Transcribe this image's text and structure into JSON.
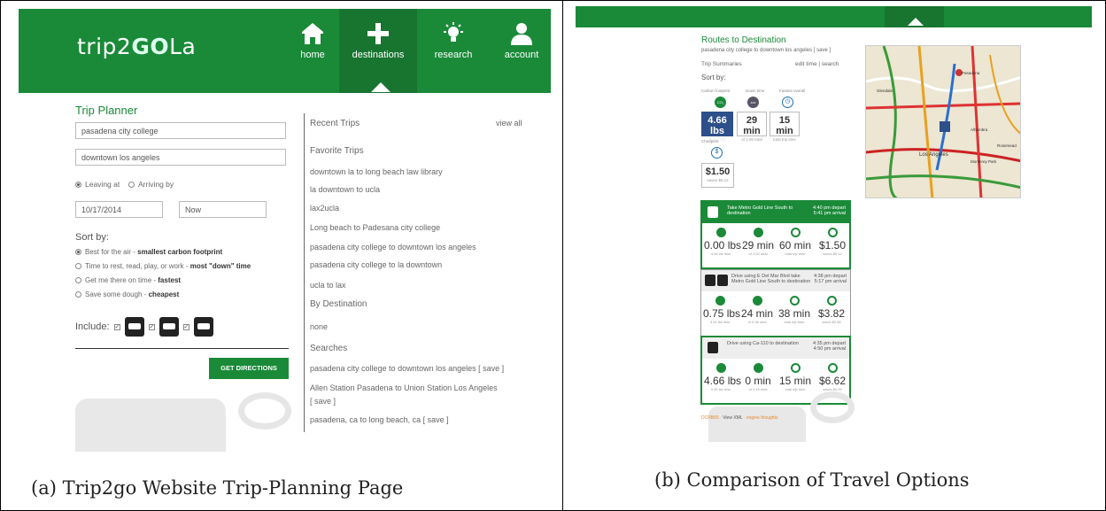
{
  "panel_a": {
    "logo_left": "trip2",
    "logo_mid": "GO",
    "logo_right": "La",
    "nav": [
      {
        "label": "home",
        "icon": "home-icon"
      },
      {
        "label": "destinations",
        "icon": "plus-icon"
      },
      {
        "label": "research",
        "icon": "lightbulb-icon"
      },
      {
        "label": "account",
        "icon": "user-icon"
      }
    ],
    "trip_planner_title": "Trip Planner",
    "from_value": "pasadena city college",
    "to_value": "downtown los angeles",
    "leaving_at": "Leaving at",
    "arriving_by": "Arriving by",
    "date_value": "10/17/2014",
    "time_value": "Now",
    "sort_by": "Sort by:",
    "sort_options": [
      {
        "pre": "Best for the air - ",
        "bold": "smallest carbon footprint"
      },
      {
        "pre": "Time to rest, read, play, or work - ",
        "bold": "most \"down\" time"
      },
      {
        "pre": "Get me there on time - ",
        "bold": "fastest"
      },
      {
        "pre": "Save some dough - ",
        "bold": "cheapest"
      }
    ],
    "include_label": "Include:",
    "get_directions": "GET DIRECTIONS",
    "recent_trips": "Recent Trips",
    "view_all": "view all",
    "favorite_trips": "Favorite Trips",
    "favorites": [
      "downtown la to long beach law library",
      "la downtown to ucla",
      "lax2ucla",
      "Long beach to Padesana city college",
      "pasadena city college to downtown los angeles",
      "pasadena city college to la downtown",
      "ucla to lax"
    ],
    "by_destination": "By Destination",
    "by_destination_value": "none",
    "searches": "Searches",
    "search_items": [
      "pasadena city college to downtown los angeles  [ save ]",
      "Allen Station Pasadena to Union Station Los Angeles",
      "[ save ]",
      "pasadena, ca to long beach, ca  [ save ]"
    ],
    "caption": "(a)  Trip2go Website Trip-Planning Page"
  },
  "panel_b": {
    "title": "Routes to Destination",
    "subtitle": "pasadena city college to downtown los angeles  [ save ]",
    "trip_summaries": "Trip Summaries",
    "edit_links": "edit time  |  search",
    "sort_by": "Sort by:",
    "sort_minis": [
      "Carbon footprint",
      "Down time",
      "Fastest overall",
      "Cheapest"
    ],
    "summary_boxes": [
      {
        "big": "4.66 lbs",
        "small": "less CO2"
      },
      {
        "big": "29 min",
        "small": "of 1:00 total"
      },
      {
        "big": "15 min",
        "small": "total trip time"
      },
      {
        "big": "$1.50",
        "small": "saves $5.12"
      }
    ],
    "routes": [
      {
        "desc": "Take Metro Gold Line South to destination",
        "times": "4:40 pm depart\n5:41 pm arrival",
        "stats": [
          {
            "v": "0.00 lbs",
            "s": "4.66 lbs less"
          },
          {
            "v": "29 min",
            "s": "of 1:00 total"
          },
          {
            "v": "60 min",
            "s": "total trip time"
          },
          {
            "v": "$1.50",
            "s": "saves $5.12"
          }
        ]
      },
      {
        "desc": "Drive using E Del Mar Blvd take Metro Gold Line South to destination",
        "times": "4:38 pm depart\n5:17 pm arrival",
        "stats": [
          {
            "v": "0.75 lbs",
            "s": "3.91 lbs less"
          },
          {
            "v": "24 min",
            "s": "of 0:38 total"
          },
          {
            "v": "38 min",
            "s": "total trip time"
          },
          {
            "v": "$3.82",
            "s": "saves $2.80"
          }
        ]
      },
      {
        "desc": "Drive using Ca-110 to destination",
        "times": "4:35 pm depart\n4:50 pm arrival",
        "stats": [
          {
            "v": "4.66 lbs",
            "s": "0.00 lbs less"
          },
          {
            "v": "0 min",
            "s": "of 0:15 total"
          },
          {
            "v": "15 min",
            "s": "total trip time"
          },
          {
            "v": "$6.62",
            "s": "saves $0.00"
          }
        ]
      }
    ],
    "footer_pre": "DCRB65 · ",
    "footer_mid": "View XML",
    "footer_post": " · engine thoughts",
    "map_labels": [
      "Glendale",
      "Pasadena",
      "Alhambra",
      "Los Angeles",
      "Monterey Park",
      "Rosemead"
    ],
    "caption": "(b)  Comparison of Travel Options"
  },
  "colors": {
    "brand_green": "#1a8a38",
    "selected_blue": "#2d4f8a"
  }
}
